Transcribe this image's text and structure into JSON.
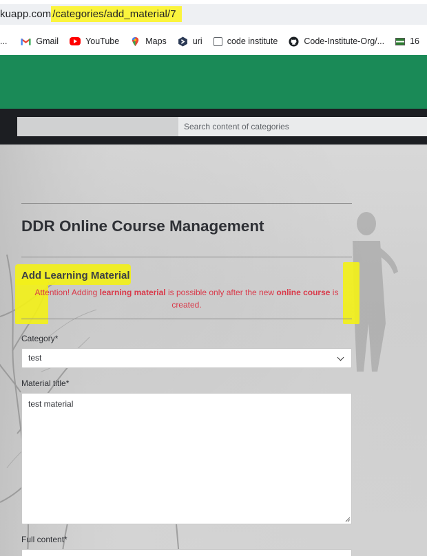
{
  "browser": {
    "url_host": "kuapp.com",
    "url_path": "/categories/add_material/7",
    "bookmarks": [
      {
        "label": "Gmail",
        "icon": "gmail-icon"
      },
      {
        "label": "YouTube",
        "icon": "youtube-icon"
      },
      {
        "label": "Maps",
        "icon": "maps-icon"
      },
      {
        "label": "uri",
        "icon": "uri-icon"
      },
      {
        "label": "code institute",
        "icon": "code-institute-icon"
      },
      {
        "label": "Code-Institute-Org/...",
        "icon": "github-icon"
      },
      {
        "label": "16",
        "icon": "flag-icon"
      }
    ],
    "bookmarks_overflow": "..."
  },
  "header": {
    "brand_color": "#1a8a57",
    "nav_color": "#1c1e22",
    "search_placeholder": "Search content of categories"
  },
  "main": {
    "page_title": "DDR Online Course Management",
    "section_title": "Add Learning Material",
    "alert": {
      "part1": "Attention! Adding ",
      "bold1": "learning material",
      "part2": " is possible only after the new ",
      "bold2": "online course",
      "part3": " is created.",
      "color": "#d93a4a"
    },
    "form": {
      "category_label": "Category*",
      "category_value": "test",
      "title_label": "Material title*",
      "title_value": "test material",
      "content_label": "Full content*"
    }
  },
  "highlight_color": "#f2f01a"
}
